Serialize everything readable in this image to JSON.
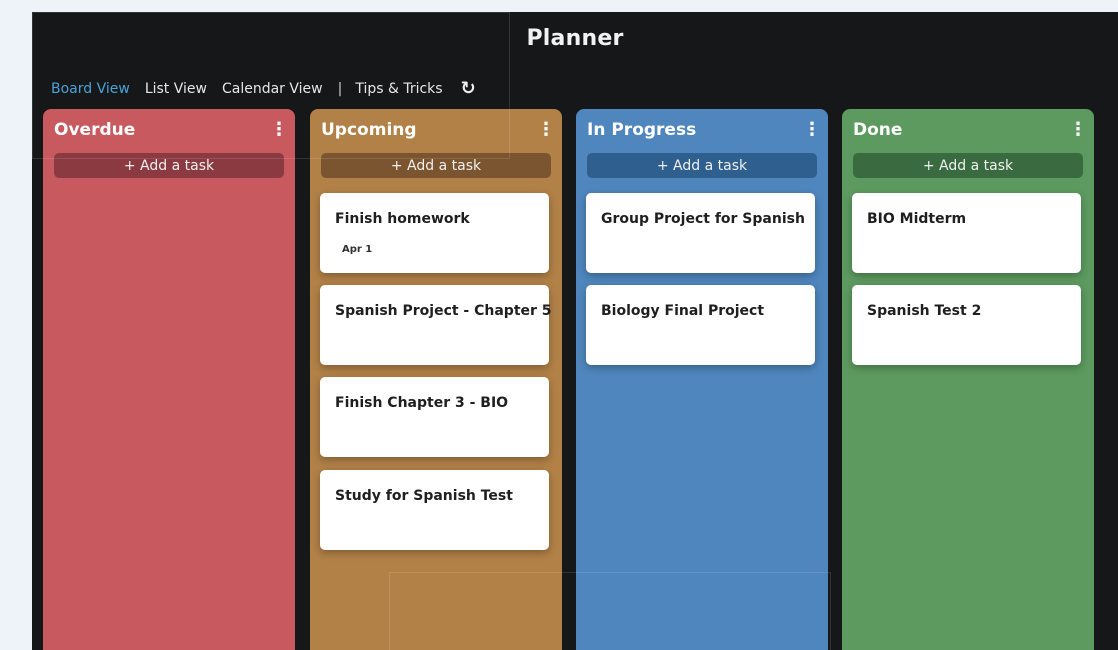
{
  "app": {
    "title": "Planner"
  },
  "nav": {
    "items": [
      "Board View",
      "List View",
      "Calendar View"
    ],
    "separator": "|",
    "tips": "Tips & Tricks",
    "refresh_glyph": "↻"
  },
  "kebab_glyph": "⋮",
  "columns": [
    {
      "name": "Overdue",
      "add_label": "+ Add a task",
      "color": "#c85a5f",
      "button_color": "#8a3a40",
      "cards": []
    },
    {
      "name": "Upcoming",
      "add_label": "+ Add a task",
      "color": "#b18147",
      "button_color": "#7a5530",
      "cards": [
        {
          "title": "Finish homework",
          "date": "Apr 1"
        },
        {
          "title": "Spanish Project - Chapter 5"
        },
        {
          "title": "Finish Chapter 3 - BIO"
        },
        {
          "title": "Study for Spanish Test"
        }
      ]
    },
    {
      "name": "In Progress",
      "add_label": "+ Add a task",
      "color": "#4f86bd",
      "button_color": "#2f5f8e",
      "cards": [
        {
          "title": "Group Project for Spanish"
        },
        {
          "title": "Biology Final Project"
        }
      ]
    },
    {
      "name": "Done",
      "add_label": "+ Add a task",
      "color": "#5c9a5f",
      "button_color": "#3a6b40",
      "cards": [
        {
          "title": "BIO Midterm"
        },
        {
          "title": "Spanish Test 2"
        }
      ]
    }
  ]
}
